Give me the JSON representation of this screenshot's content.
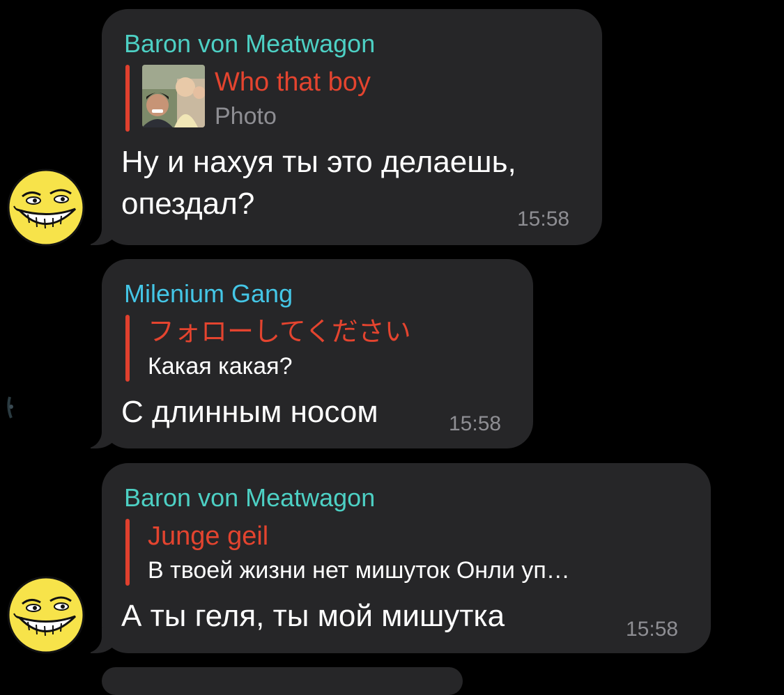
{
  "messages": [
    {
      "sender": "Baron von Meatwagon",
      "reply_title": "Who that boy",
      "reply_text": "Photo",
      "text_line1": "Ну и нахуя ты это делаешь,",
      "text_line2": "опездал?",
      "time": "15:58"
    },
    {
      "sender": "Milenium Gang",
      "reply_title": "フォローしてください",
      "reply_text": "Какая какая?",
      "text": "С длинным носом",
      "time": "15:58"
    },
    {
      "sender": "Baron von Meatwagon",
      "reply_title": "Junge geil",
      "reply_text": "В твоей жизни нет мишуток Онли уп…",
      "text": "А ты геля, ты мой мишутка",
      "time": "15:58"
    }
  ],
  "colors": {
    "background": "#000000",
    "bubble": "#262628",
    "sender_baron": "#4dd0c4",
    "sender_milenium": "#44c6e6",
    "reply_accent": "#e0402e",
    "timestamp": "#8e8e93"
  },
  "icons": {
    "avatar_baron": "trollface-avatar-icon",
    "avatar_milenium": "dark-avatar-icon",
    "reply_thumbnail": "photo-thumbnail-icon"
  }
}
